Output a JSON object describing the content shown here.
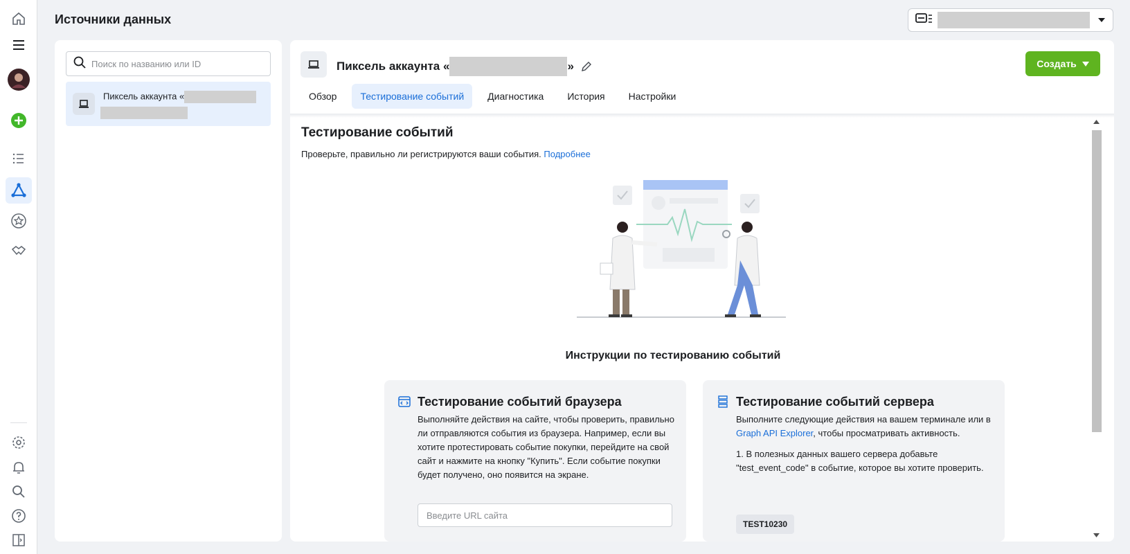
{
  "header": {
    "title": "Источники данных"
  },
  "search": {
    "placeholder": "Поиск по названию или ID"
  },
  "sources": [
    {
      "name_prefix": "Пиксель аккаунта «"
    }
  ],
  "pixel": {
    "title_prefix": "Пиксель аккаунта «",
    "title_suffix": "»",
    "create_label": "Создать"
  },
  "tabs": [
    {
      "label": "Обзор",
      "active": false
    },
    {
      "label": "Тестирование событий",
      "active": true
    },
    {
      "label": "Диагностика",
      "active": false
    },
    {
      "label": "История",
      "active": false
    },
    {
      "label": "Настройки",
      "active": false
    }
  ],
  "content": {
    "title": "Тестирование событий",
    "description": "Проверьте, правильно ли регистрируются ваши события.",
    "learn_more": "Подробнее",
    "instructions_title": "Инструкции по тестированию событий"
  },
  "browser_card": {
    "title": "Тестирование событий браузера",
    "body": "Выполняйте действия на сайте, чтобы проверить, правильно ли отправляются события из браузера. Например, если вы хотите протестировать событие покупки, перейдите на свой сайт и нажмите на кнопку \"Купить\". Если событие покупки будет получено, оно появится на экране.",
    "url_placeholder": "Введите URL сайта"
  },
  "server_card": {
    "title": "Тестирование событий сервера",
    "body_before_link": "Выполните следующие действия на вашем терминале или в ",
    "link": "Graph API Explorer",
    "body_after_link": ", чтобы просматривать активность.",
    "step1": "1. В полезных данных вашего сервера добавьте \"test_event_code\" в событие, которое вы хотите проверить.",
    "code": "TEST10230"
  },
  "icons": {
    "rail": [
      "home-icon",
      "menu-icon",
      "avatar",
      "add-icon",
      "list-icon",
      "events-manager-icon",
      "star-icon",
      "handshake-icon",
      "settings-icon",
      "bell-icon",
      "search-icon",
      "help-icon",
      "panel-toggle-icon"
    ]
  },
  "colors": {
    "accent": "#1a6ed8",
    "create_button": "#5fb420",
    "active_tab_bg": "#e7f0fd"
  }
}
